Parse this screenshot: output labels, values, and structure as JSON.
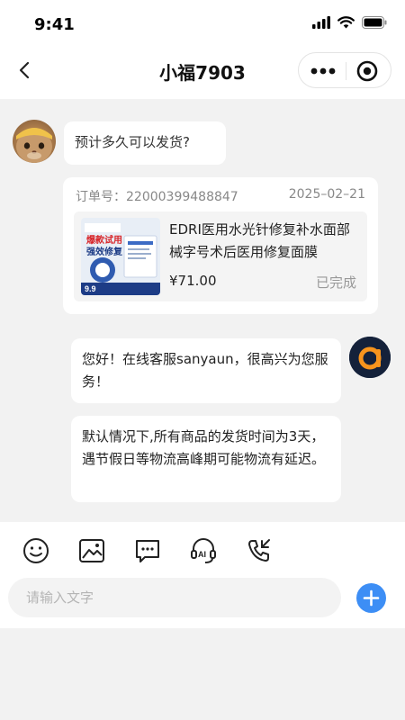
{
  "status_bar": {
    "time": "9:41",
    "icons": [
      "signal-icon",
      "wifi-icon",
      "battery-icon"
    ]
  },
  "nav": {
    "title": "小福7903",
    "back_icon": "chevron-left-icon",
    "more_icon": "more-dots-icon",
    "close_icon": "target-circle-icon"
  },
  "messages": {
    "user_question": "预计多久可以发货?",
    "agent_greeting": "您好！在线客服sanyaun，很高兴为您服务！",
    "agent_shipping": "默认情况下,所有商品的发货时间为3天，遇节假日等物流高峰期可能物流有延迟。"
  },
  "order_card": {
    "order_no": "订单号：22000399488847",
    "date": "2025–02–21",
    "product_title": "EDRI医用水光针修复补水面部械字号术后医用修复面膜",
    "price": "¥71.00",
    "status": "已完成",
    "image_badge_top": "爆款试用",
    "image_badge_main": "强效修复",
    "image_price": "9.9"
  },
  "toolbar": {
    "icons": [
      "emoji-icon",
      "image-icon",
      "chat-message-icon",
      "ai-headset-icon",
      "phone-call-icon"
    ],
    "input_placeholder": "请输入文字",
    "plus_icon": "plus-icon"
  },
  "colors": {
    "accent": "#3d8ef5",
    "agent_avatar_bg": "#14213a",
    "agent_avatar_mark": "#f7941d"
  }
}
